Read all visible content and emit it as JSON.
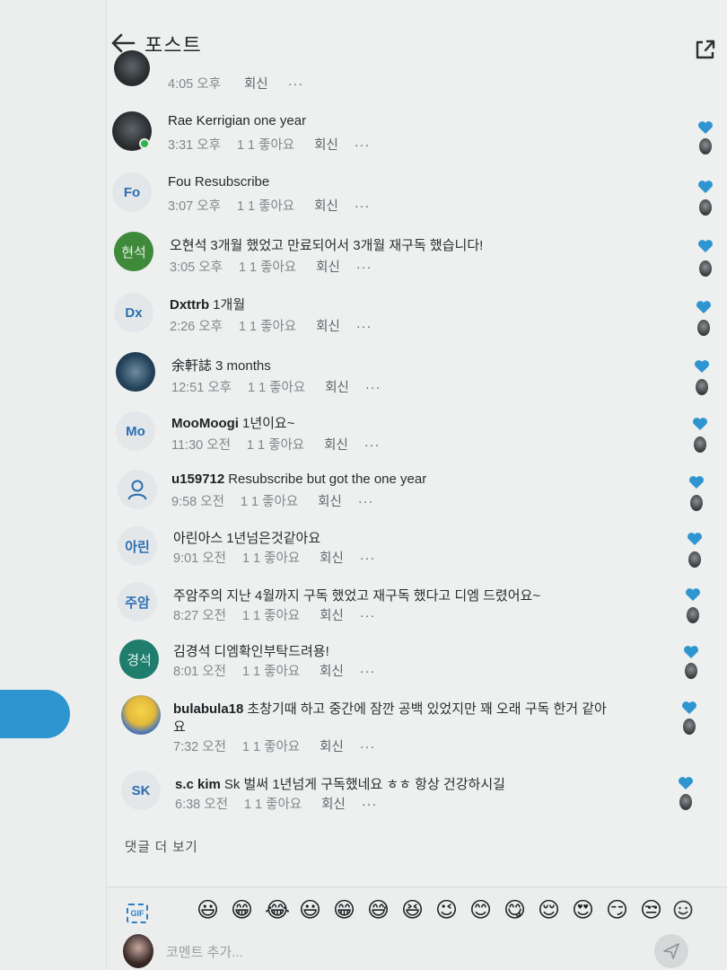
{
  "header": {
    "title": "포스트"
  },
  "top_partial": {
    "time": "4:05 오후",
    "reply": "회신",
    "more": "···"
  },
  "comments": [
    {
      "initials": "",
      "user": "Rae Kerrigian",
      "text": "one year",
      "time": "3:31 오후",
      "likes": "1 1 좋아요",
      "reply": "회신",
      "more": "···"
    },
    {
      "initials": "Fo",
      "user": "Fou",
      "text": "Resubscribe",
      "time": "3:07 오후",
      "likes": "1 1 좋아요",
      "reply": "회신",
      "more": "···"
    },
    {
      "initials": "현석",
      "user": "오현석",
      "text": "3개월 했었고 만료되어서 3개월 재구독 했습니다!",
      "time": "3:05 오후",
      "likes": "1 1 좋아요",
      "reply": "회신",
      "more": "···"
    },
    {
      "initials": "Dx",
      "user": "Dxttrb",
      "text": "1개월",
      "time": "2:26 오후",
      "likes": "1 1 좋아요",
      "reply": "회신",
      "more": "···"
    },
    {
      "initials": "",
      "user": "余軒誌",
      "text": "3 months",
      "time": "12:51 오후",
      "likes": "1 1 좋아요",
      "reply": "회신",
      "more": "···"
    },
    {
      "initials": "Mo",
      "user": "MooMoogi",
      "text": "1년이요~",
      "time": "11:30 오전",
      "likes": "1 1 좋아요",
      "reply": "회신",
      "more": "···"
    },
    {
      "initials": "",
      "user": "u159712",
      "text": "Resubscribe but got the one year",
      "time": "9:58 오전",
      "likes": "1 1 좋아요",
      "reply": "회신",
      "more": "···"
    },
    {
      "initials": "아린",
      "user": "아린아스",
      "text": "1년넘은것같아요",
      "time": "9:01 오전",
      "likes": "1 1 좋아요",
      "reply": "회신",
      "more": "···"
    },
    {
      "initials": "주암",
      "user": "주암주의",
      "text": "지난 4월까지 구독 했었고 재구독 했다고 디엠 드렸어요~",
      "time": "8:27 오전",
      "likes": "1 1 좋아요",
      "reply": "회신",
      "more": "···"
    },
    {
      "initials": "경석",
      "user": "김경석",
      "text": "디엠확인부탁드려용!",
      "time": "8:01 오전",
      "likes": "1 1 좋아요",
      "reply": "회신",
      "more": "···"
    },
    {
      "initials": "",
      "user": "bulabula18",
      "text": "초창기때 하고 중간에 잠깐 공백 있었지만 꽤 오래 구독 한거 같아",
      "text2": "요",
      "time": "7:32 오전",
      "likes": "1 1 좋아요",
      "reply": "회신",
      "more": "···"
    },
    {
      "initials": "SK",
      "user": "s.c kim",
      "text": "Sk 벌써 1년넘게 구독했네요 ㅎㅎ 항상 건강하시길",
      "time": "6:38 오전",
      "likes": "1 1 좋아요",
      "reply": "회신",
      "more": "···"
    }
  ],
  "more_comments_label": "댓글 더 보기",
  "composer": {
    "gif_label": "GIF",
    "emojis": [
      "😃",
      "😁",
      "😂",
      "😃",
      "😁",
      "😅",
      "😆",
      "😉",
      "😊",
      "😋",
      "😌",
      "😍",
      "😏",
      "😒"
    ],
    "placeholder": "코멘트 추가..."
  },
  "colors": {
    "accent": "#2f95d1",
    "heart": "#2f95d1"
  }
}
